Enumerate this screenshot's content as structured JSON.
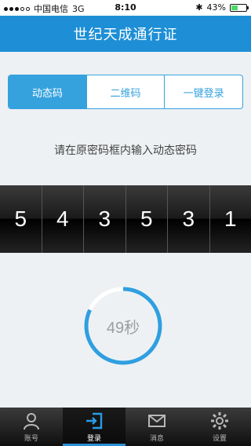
{
  "status_bar": {
    "carrier": "中国电信",
    "network": "3G",
    "time": "8:10",
    "battery": "43%",
    "battery_level": 0.43,
    "bluetooth_icon": "bluetooth-icon"
  },
  "nav": {
    "title": "世纪天成通行证"
  },
  "segments": [
    {
      "label": "动态码",
      "active": true
    },
    {
      "label": "二维码",
      "active": false
    },
    {
      "label": "一键登录",
      "active": false
    }
  ],
  "hint": "请在原密码框内输入动态密码",
  "code_digits": [
    "5",
    "4",
    "3",
    "5",
    "3",
    "1"
  ],
  "countdown": {
    "label": "49秒",
    "fraction_remaining": 0.82
  },
  "tabs": [
    {
      "label": "账号",
      "icon": "person-icon",
      "active": false
    },
    {
      "label": "登录",
      "icon": "login-icon",
      "active": true
    },
    {
      "label": "消息",
      "icon": "mail-icon",
      "active": false
    },
    {
      "label": "设置",
      "icon": "gear-icon",
      "active": false
    }
  ],
  "colors": {
    "accent": "#1e8fd6",
    "segment": "#35a2de",
    "ring": "#2f9fe0"
  }
}
